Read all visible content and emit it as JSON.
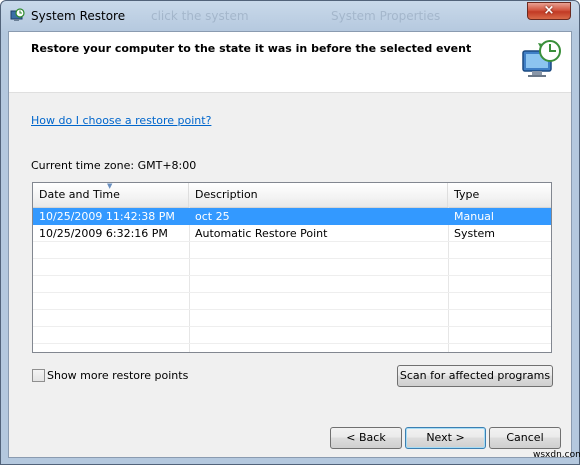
{
  "window": {
    "title": "System Restore",
    "ghost_text_1": "click the system",
    "ghost_text_2": "System Properties",
    "close_glyph": "×"
  },
  "header": {
    "title": "Restore your computer to the state it was in before the selected event",
    "icon": "system-restore-icon"
  },
  "help_link": "How do I choose a restore point?",
  "timezone_label": "Current time zone: GMT+8:00",
  "table": {
    "columns": [
      "Date and Time",
      "Description",
      "Type"
    ],
    "rows": [
      {
        "date": "10/25/2009 11:42:38 PM",
        "description": "oct 25",
        "type": "Manual",
        "selected": true
      },
      {
        "date": "10/25/2009 6:32:16 PM",
        "description": "Automatic Restore Point",
        "type": "System",
        "selected": false
      }
    ]
  },
  "show_more": {
    "label": "Show more restore points",
    "checked": false
  },
  "buttons": {
    "scan": "Scan for affected programs",
    "back": "< Back",
    "next": "Next >",
    "cancel": "Cancel"
  },
  "watermark": "wsxdn.com",
  "colors": {
    "selection": "#3399ff",
    "link": "#0066cc"
  }
}
